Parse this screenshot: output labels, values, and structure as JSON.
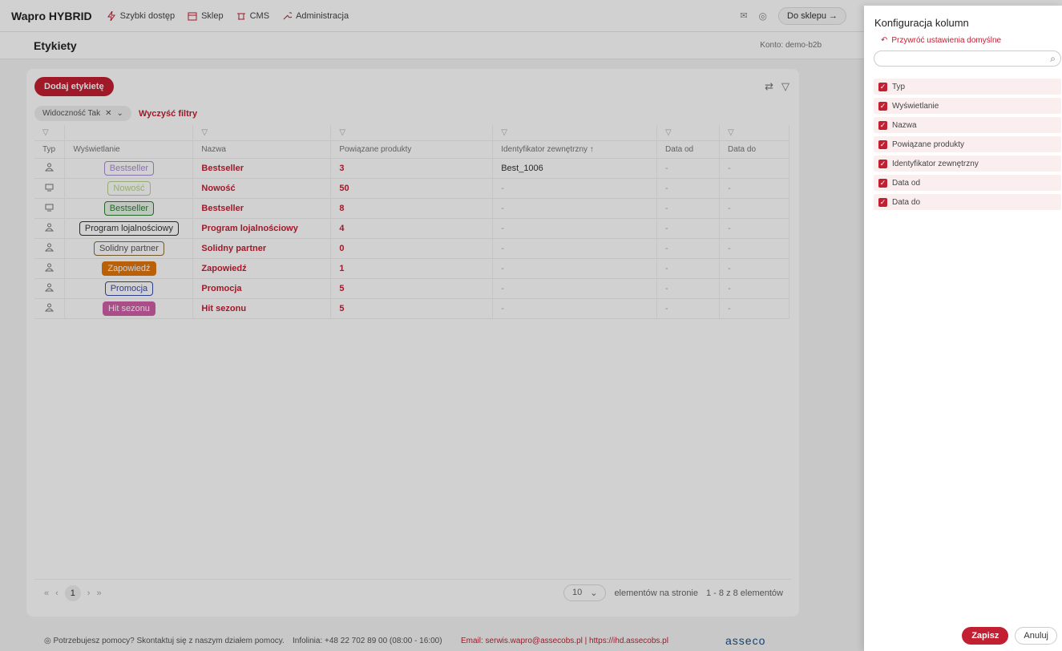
{
  "topnav": {
    "brand": "Wapro HYBRID",
    "items": [
      "Szybki dostęp",
      "Sklep",
      "CMS",
      "Administracja"
    ],
    "shop_button": "Do sklepu →"
  },
  "subheader": {
    "title": "Etykiety",
    "account": "Konto: demo-b2b"
  },
  "toolbar": {
    "add_label": "Dodaj etykietę",
    "filter_chip": "Widoczność Tak",
    "clear_filters": "Wyczyść filtry"
  },
  "table": {
    "headers": [
      "Typ",
      "Wyświetlanie",
      "Nazwa",
      "Powiązane produkty",
      "Identyfikator zewnętrzny ↑",
      "Data od",
      "Data do"
    ],
    "rows": [
      {
        "type_icon": "user-icon",
        "badge": "Bestseller",
        "badge_color": "#a98bd3",
        "badge_bg": "#ffffff",
        "badge_text": "#a98bd3",
        "name": "Bestseller",
        "count": "3",
        "ext": "Best_1006",
        "from": "-",
        "to": "-"
      },
      {
        "type_icon": "monitor-icon",
        "badge": "Nowość",
        "badge_color": "#b6d48a",
        "badge_bg": "#ffffff",
        "badge_text": "#b6d48a",
        "name": "Nowość",
        "count": "50",
        "ext": "-",
        "from": "-",
        "to": "-"
      },
      {
        "type_icon": "monitor-icon",
        "badge": "Bestseller",
        "badge_color": "#2e7d32",
        "badge_bg": "#e9f5e9",
        "badge_text": "#2e7d32",
        "name": "Bestseller",
        "count": "8",
        "ext": "-",
        "from": "-",
        "to": "-"
      },
      {
        "type_icon": "user-icon",
        "badge": "Program lojalnościowy",
        "badge_color": "#333333",
        "badge_bg": "#ffffff",
        "badge_text": "#333333",
        "name": "Program lojalnościowy",
        "count": "4",
        "ext": "-",
        "from": "-",
        "to": "-"
      },
      {
        "type_icon": "user-icon",
        "badge": "Solidny partner",
        "badge_color": "#8a6d3b",
        "badge_bg": "#ffffff",
        "badge_text": "#555555",
        "name": "Solidny partner",
        "count": "0",
        "ext": "-",
        "from": "-",
        "to": "-"
      },
      {
        "type_icon": "user-icon",
        "badge": "Zapowiedź",
        "badge_color": "#e3760a",
        "badge_bg": "#e3760a",
        "badge_text": "#ffffff",
        "name": "Zapowiedź",
        "count": "1",
        "ext": "-",
        "from": "-",
        "to": "-"
      },
      {
        "type_icon": "user-icon",
        "badge": "Promocja",
        "badge_color": "#3949ab",
        "badge_bg": "#ffffff",
        "badge_text": "#3949ab",
        "name": "Promocja",
        "count": "5",
        "ext": "-",
        "from": "-",
        "to": "-"
      },
      {
        "type_icon": "user-icon",
        "badge": "Hit sezonu",
        "badge_color": "#d05fa8",
        "badge_bg": "#d05fa8",
        "badge_text": "#ffffff",
        "name": "Hit sezonu",
        "count": "5",
        "ext": "-",
        "from": "-",
        "to": "-"
      }
    ]
  },
  "pager": {
    "page": "1",
    "page_size": "10",
    "per_page_label": "elementów na stronie",
    "summary": "1 - 8 z 8 elementów"
  },
  "footer": {
    "help": "Potrzebujesz pomocy? Skontaktuj się z naszym działem pomocy.",
    "phone": "Infolinia: +48 22 702 89 00 (08:00 - 16:00)",
    "email": "Email: serwis.wapro@assecobs.pl | https://ihd.assecobs.pl",
    "logo": "asseco"
  },
  "panel": {
    "title": "Konfiguracja kolumn",
    "restore": "Przywróć ustawienia domyślne",
    "search_placeholder": "",
    "columns": [
      "Typ",
      "Wyświetlanie",
      "Nazwa",
      "Powiązane produkty",
      "Identyfikator zewnętrzny",
      "Data od",
      "Data do"
    ],
    "save": "Zapisz",
    "cancel": "Anuluj"
  },
  "colors": {
    "accent": "#c21f32"
  }
}
